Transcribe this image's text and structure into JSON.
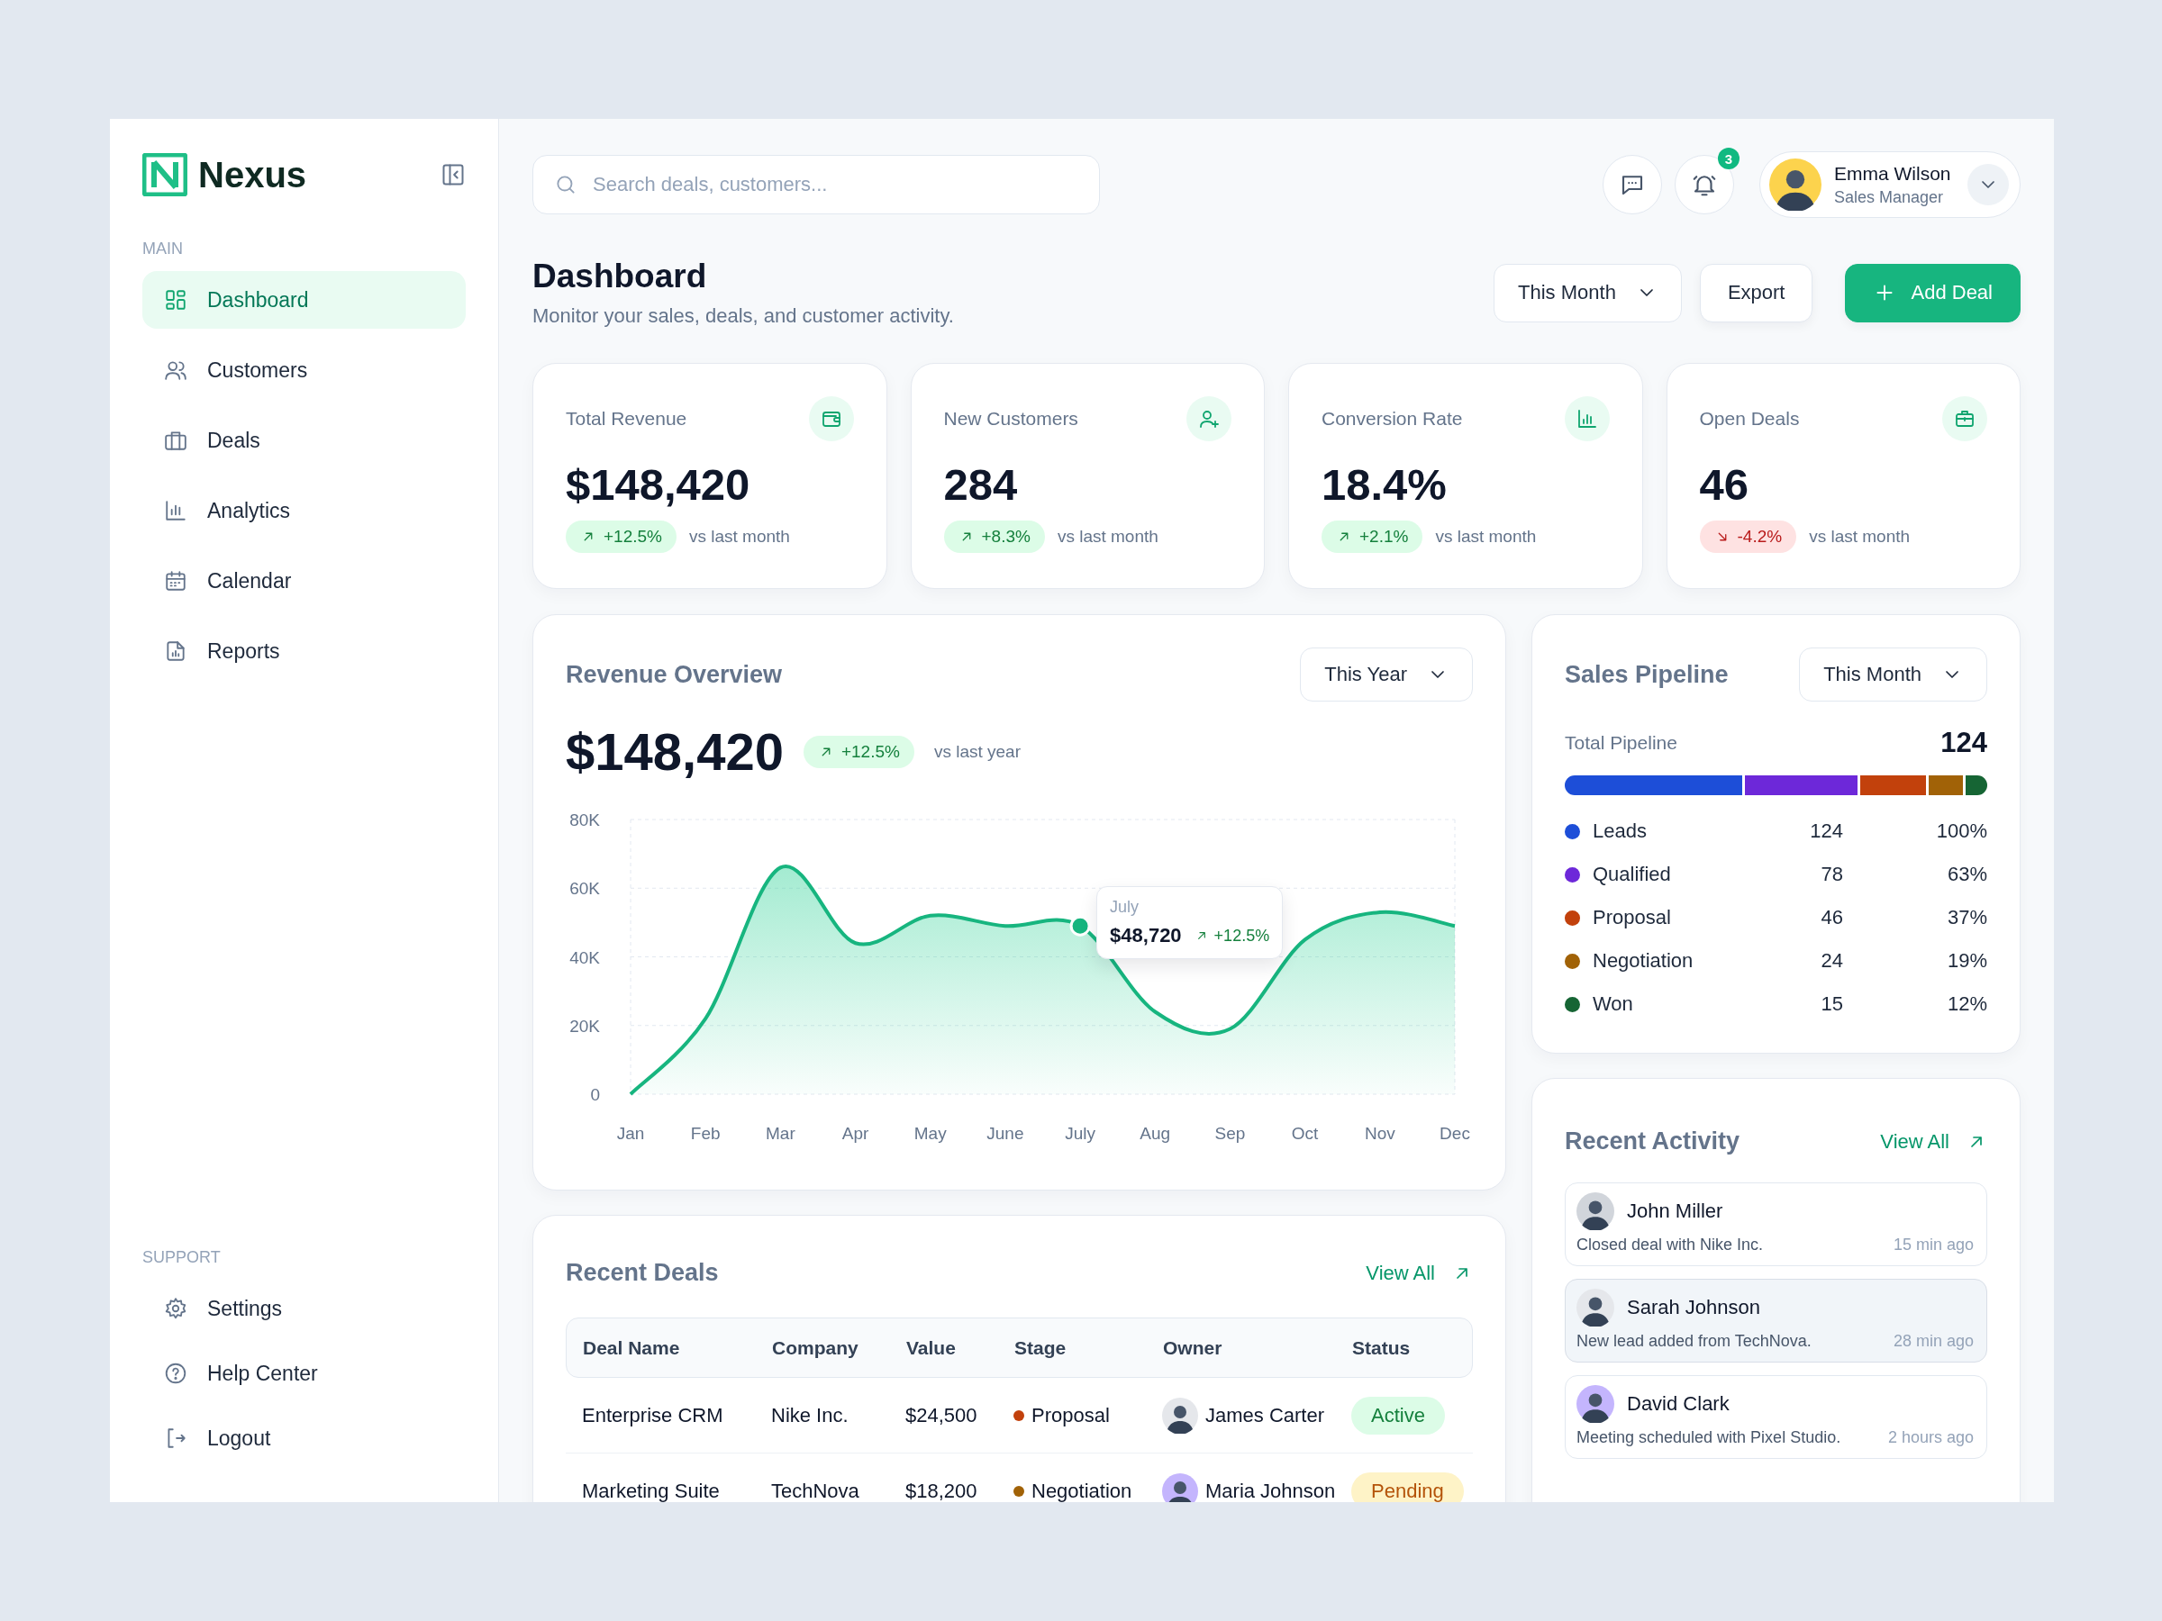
{
  "brand": {
    "name": "Nexus"
  },
  "sidebar": {
    "sections": [
      {
        "heading": "MAIN",
        "items": [
          {
            "label": "Dashboard",
            "selected": true
          },
          {
            "label": "Customers",
            "selected": false
          },
          {
            "label": "Deals",
            "selected": false
          },
          {
            "label": "Analytics",
            "selected": false
          },
          {
            "label": "Calendar",
            "selected": false
          },
          {
            "label": "Reports",
            "selected": false
          }
        ]
      },
      {
        "heading": "SUPPORT",
        "items": [
          {
            "label": "Settings",
            "selected": false
          },
          {
            "label": "Help Center",
            "selected": false
          },
          {
            "label": "Logout",
            "selected": false
          }
        ]
      }
    ]
  },
  "topbar": {
    "search": {
      "placeholder": "Search deals, customers..."
    },
    "notifications": "3",
    "user": {
      "name": "Emma Wilson",
      "role": "Sales Manager"
    }
  },
  "header": {
    "title": "Dashboard",
    "subtitle": "Monitor your sales, deals, and customer activity.",
    "period": "This Month",
    "buttons": [
      "Export",
      "Add Deal"
    ]
  },
  "kpis": [
    {
      "label": "Total Revenue",
      "value": "$148,420",
      "change": "+12.5%",
      "rising": true,
      "note": "vs last month"
    },
    {
      "label": "New Customers",
      "value": "284",
      "change": "+8.3%",
      "rising": true,
      "note": "vs last month"
    },
    {
      "label": "Conversion Rate",
      "value": "18.4%",
      "change": "+2.1%",
      "rising": true,
      "note": "vs last month"
    },
    {
      "label": "Open Deals",
      "value": "46",
      "change": "-4.2%",
      "rising": false,
      "note": "vs last month"
    }
  ],
  "revenue": {
    "title": "Revenue Overview",
    "period": "This Year",
    "value": "$148,420",
    "change": "+12.5%",
    "rising": true,
    "note": "vs last year",
    "chart_data": {
      "type": "area",
      "grid": true,
      "categories": [
        "Jan",
        "Feb",
        "Mar",
        "Apr",
        "May",
        "June",
        "July",
        "Aug",
        "Sep",
        "Oct",
        "Nov",
        "Dec"
      ],
      "values": [
        0,
        22000,
        66000,
        44000,
        52000,
        49000,
        49000,
        24000,
        19000,
        45000,
        53000,
        49000
      ],
      "ylim": [
        0,
        80000
      ],
      "yticks": [
        {
          "value": 0,
          "label": "0"
        },
        {
          "value": 20000,
          "label": "20K"
        },
        {
          "value": 40000,
          "label": "40K"
        },
        {
          "value": 60000,
          "label": "60K"
        },
        {
          "value": 80000,
          "label": "80K"
        }
      ]
    },
    "tooltip": {
      "label": "July",
      "value": "$48,720",
      "change": "+12.5%"
    }
  },
  "pipeline": {
    "title": "Sales Pipeline",
    "period": "This Month",
    "total_label": "Total Pipeline",
    "total": "124",
    "stages": [
      {
        "name": "Leads",
        "count": "124",
        "share": "100%",
        "color": "#1d4ed8"
      },
      {
        "name": "Qualified",
        "count": "78",
        "share": "63%",
        "color": "#6d28d9"
      },
      {
        "name": "Proposal",
        "count": "46",
        "share": "37%",
        "color": "#c2410c"
      },
      {
        "name": "Negotiation",
        "count": "24",
        "share": "19%",
        "color": "#a16207"
      },
      {
        "name": "Won",
        "count": "15",
        "share": "12%",
        "color": "#166534"
      }
    ]
  },
  "activity": {
    "title": "Recent Activity",
    "link": "View All",
    "items": [
      {
        "name": "John Miller",
        "text": "Closed deal with Nike Inc.",
        "time": "15 min ago",
        "selected": false
      },
      {
        "name": "Sarah Johnson",
        "text": "New lead added from TechNova.",
        "time": "28 min ago",
        "selected": true
      },
      {
        "name": "David Clark",
        "text": "Meeting scheduled with Pixel Studio.",
        "time": "2 hours ago",
        "selected": false
      }
    ]
  },
  "deals": {
    "title": "Recent Deals",
    "link": "View All",
    "columns": [
      "Deal Name",
      "Company",
      "Value",
      "Stage",
      "Owner",
      "Status"
    ],
    "rows": [
      {
        "deal": "Enterprise CRM",
        "company": "Nike Inc.",
        "value": "$24,500",
        "stage": {
          "label": "Proposal",
          "color": "#c2410c"
        },
        "owner": "James Carter",
        "status": {
          "label": "Active",
          "kind": "success"
        }
      },
      {
        "deal": "Marketing Suite",
        "company": "TechNova",
        "value": "$18,200",
        "stage": {
          "label": "Negotiation",
          "color": "#a16207"
        },
        "owner": "Maria Johnson",
        "status": {
          "label": "Pending",
          "kind": "warning"
        }
      }
    ]
  }
}
